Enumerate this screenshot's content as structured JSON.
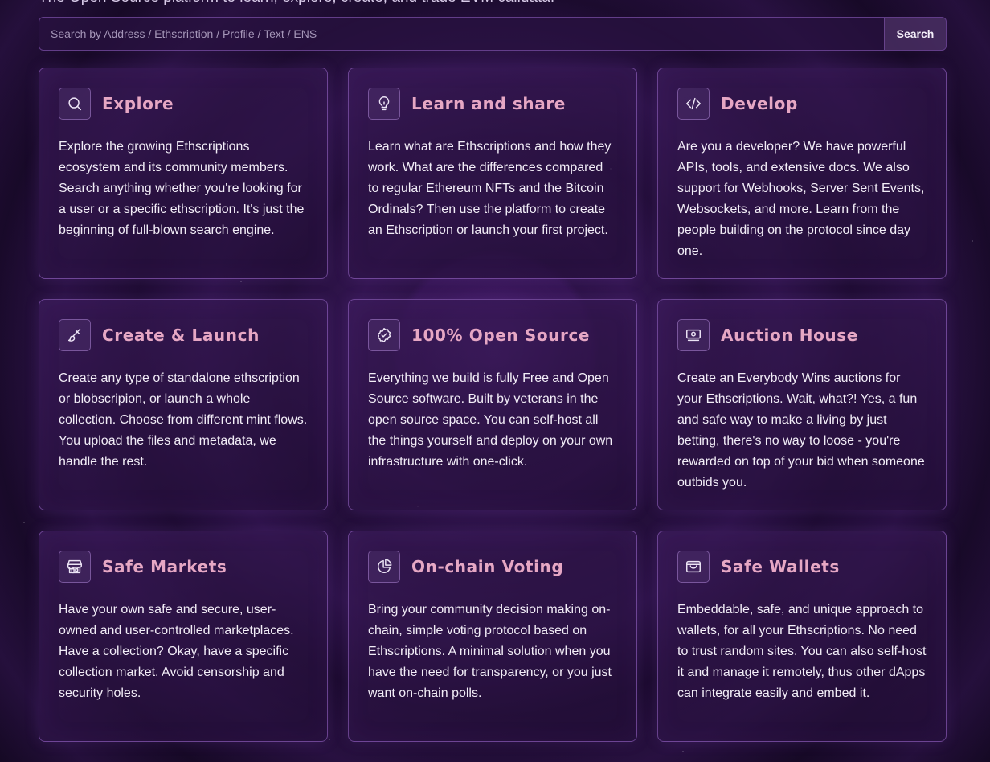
{
  "header": {
    "tagline": "The Open Source platform to learn, explore, create, and trade EVM calldata."
  },
  "search": {
    "placeholder": "Search by Address / Ethscription / Profile / Text / ENS",
    "button_label": "Search"
  },
  "cards": [
    {
      "title": "Explore",
      "icon": "search-icon",
      "body": "Explore the growing Ethscriptions ecosystem and its community members. Search anything whether you're looking for a user or a specific ethscription. It's just the beginning of full-blown search engine."
    },
    {
      "title": "Learn and share",
      "icon": "lightbulb-icon",
      "body": "Learn what are Ethscriptions and how they work. What are the differences compared to regular Ethereum NFTs and the Bitcoin Ordinals? Then use the platform to create an Ethscription or launch your first project."
    },
    {
      "title": "Develop",
      "icon": "code-icon",
      "body": "Are you a developer? We have powerful APIs, tools, and extensive docs. We also support for Webhooks, Server Sent Events, Websockets, and more. Learn from the people building on the protocol since day one."
    },
    {
      "title": "Create & Launch",
      "icon": "brush-icon",
      "body": "Create any type of standalone ethscription or blobscripion, or launch a whole collection. Choose from different mint flows. You upload the files and metadata, we handle the rest."
    },
    {
      "title": "100% Open Source",
      "icon": "badge-check-icon",
      "body": "Everything we build is fully Free and Open Source software. Built by veterans in the open source space. You can self-host all the things yourself and deploy on your own infrastructure with one-click."
    },
    {
      "title": "Auction House",
      "icon": "banknote-icon",
      "body": "Create an Everybody Wins auctions for your Ethscriptions. Wait, what?! Yes, a fun and safe way to make a living by just betting, there's no way to loose - you're rewarded on top of your bid when someone outbids you."
    },
    {
      "title": "Safe Markets",
      "icon": "store-icon",
      "body": "Have your own safe and secure, user-owned and user-controlled marketplaces. Have a collection? Okay, have a specific collection market. Avoid censorship and security holes."
    },
    {
      "title": "On-chain Voting",
      "icon": "pie-chart-icon",
      "body": "Bring your community decision making on-chain, simple voting protocol based on Ethscriptions. A minimal solution when you have the need for transparency, or you just want on-chain polls."
    },
    {
      "title": "Safe Wallets",
      "icon": "wallet-icon",
      "body": "Embeddable, safe, and unique approach to wallets, for all your Ethscriptions. No need to trust random sites. You can also self-host it and manage it remotely, thus other dApps can integrate easily and embed it."
    }
  ],
  "colors": {
    "title_accent": "#e6a7c4",
    "card_border": "#a06ed2",
    "background": "#1d0c30"
  }
}
